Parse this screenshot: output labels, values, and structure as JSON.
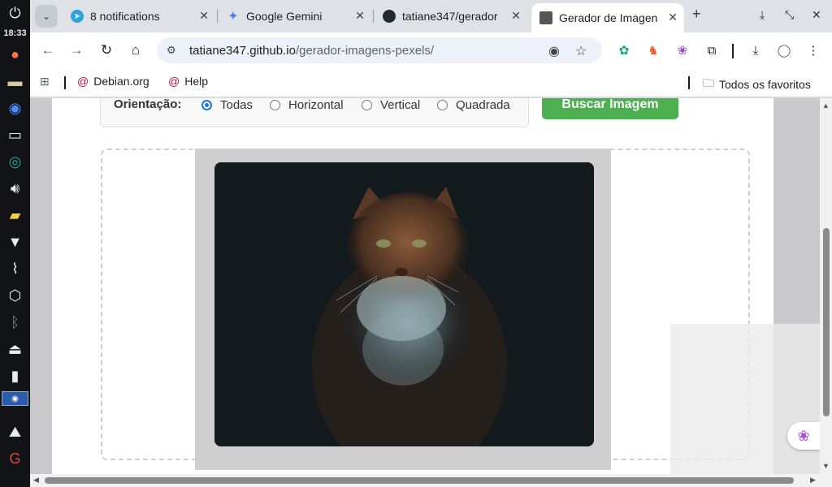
{
  "system_panel": {
    "clock": "18:33"
  },
  "tabs": [
    {
      "title": "8 notifications",
      "icon": "telegram-icon",
      "color": "#2aa3e0"
    },
    {
      "title": "Google Gemini",
      "icon": "gemini-icon",
      "color": "#4e7cf6"
    },
    {
      "title": "tatiane347/gerador",
      "icon": "github-icon",
      "color": "#24292f"
    },
    {
      "title": "Gerador de Imagens",
      "icon": "site-icon",
      "color": "#444444",
      "active": true
    }
  ],
  "tab_actions": {
    "new_tab": "+"
  },
  "toolbar": {
    "url_host": "tatiane347.github.io",
    "url_path": "/gerador-imagens-pexels/"
  },
  "bookmarks": {
    "items": [
      {
        "label": "Debian.org",
        "icon": "debian-icon"
      },
      {
        "label": "Help",
        "icon": "debian-icon"
      }
    ],
    "all_bookmarks": "Todos os favoritos"
  },
  "page": {
    "filter_label": "Orientação:",
    "orientation_options": [
      {
        "label": "Todas",
        "checked": true
      },
      {
        "label": "Horizontal",
        "checked": false
      },
      {
        "label": "Vertical",
        "checked": false
      },
      {
        "label": "Quadrada",
        "checked": false
      }
    ],
    "search_button": "Buscar Imagem",
    "image": {
      "alt": "Gato em fundo escuro"
    }
  },
  "colors": {
    "accent_green": "#4caf50",
    "radio_blue": "#1a73e8"
  }
}
